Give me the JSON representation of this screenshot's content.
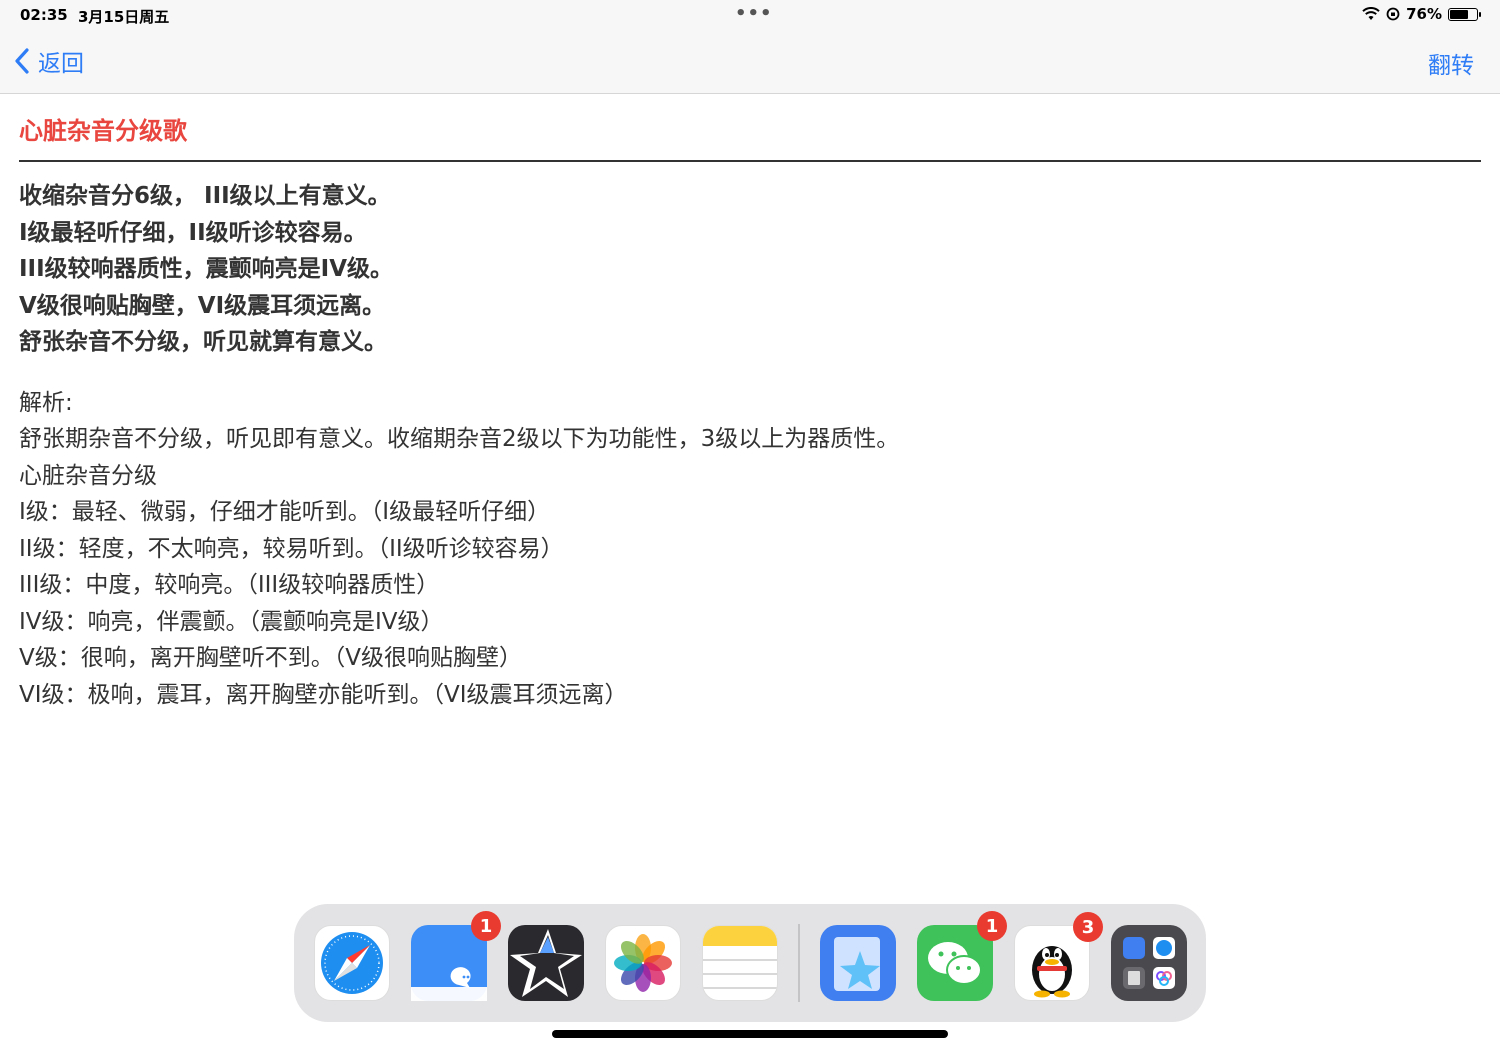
{
  "status_bar": {
    "time": "02:35",
    "date": "3月15日周五",
    "battery": "76%",
    "battery_level": 0.76
  },
  "nav": {
    "back_label": "返回",
    "flip_label": "翻转"
  },
  "document": {
    "title": "心脏杂音分级歌",
    "verse": [
      "收缩杂音分6级， III级以上有意义。",
      "I级最轻听仔细，II级听诊较容易。",
      "III级较响器质性，震颤响亮是IV级。",
      "V级很响贴胸壁，VI级震耳须远离。",
      "舒张杂音不分级，听见就算有意义。"
    ],
    "analysis": [
      "解析:",
      "舒张期杂音不分级，听见即有意义。收缩期杂音2级以下为功能性，3级以上为器质性。",
      "心脏杂音分级",
      "I级：最轻、微弱，仔细才能听到。（I级最轻听仔细）",
      "II级：轻度，不太响亮，较易听到。（II级听诊较容易）",
      "III级：中度，较响亮。（III级较响器质性）",
      "IV级：响亮，伴震颤。（震颤响亮是IV级）",
      "V级：很响，离开胸壁听不到。（V级很响贴胸壁）",
      "VI级：极响，震耳，离开胸壁亦能听到。（VI级震耳须远离）"
    ]
  },
  "dock": {
    "apps": [
      {
        "icon": "safari-icon"
      },
      {
        "icon": "messages-icon",
        "badge": "1"
      },
      {
        "icon": "star-app-icon"
      },
      {
        "icon": "photos-icon"
      },
      {
        "icon": "notes-icon"
      },
      {
        "icon": "bookmark-star-app-icon"
      },
      {
        "icon": "wechat-icon",
        "badge": "1"
      },
      {
        "icon": "qq-icon",
        "badge": "3"
      },
      {
        "icon": "app-library-icon"
      }
    ]
  },
  "colors": {
    "accent": "#2f7df6",
    "title_red": "#e8463f",
    "badge_red": "#ea3b30"
  }
}
